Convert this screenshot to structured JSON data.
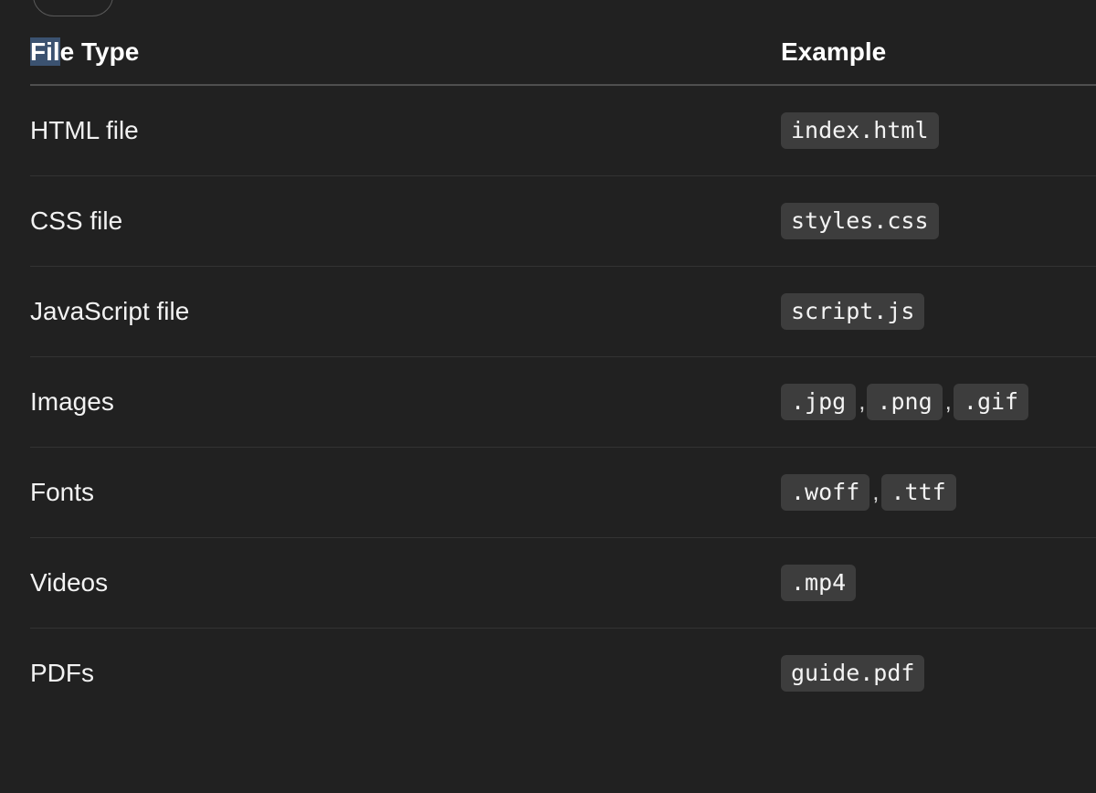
{
  "table": {
    "headers": {
      "file_type_highlight": "Fil",
      "file_type_rest": "e Type",
      "example": "Example"
    },
    "rows": [
      {
        "type": "HTML file",
        "examples": [
          "index.html"
        ]
      },
      {
        "type": "CSS file",
        "examples": [
          "styles.css"
        ]
      },
      {
        "type": "JavaScript file",
        "examples": [
          "script.js"
        ]
      },
      {
        "type": "Images",
        "examples": [
          ".jpg",
          ".png",
          ".gif"
        ]
      },
      {
        "type": "Fonts",
        "examples": [
          ".woff",
          ".ttf"
        ]
      },
      {
        "type": "Videos",
        "examples": [
          ".mp4"
        ]
      },
      {
        "type": "PDFs",
        "examples": [
          "guide.pdf"
        ]
      }
    ],
    "separator": ","
  },
  "colors": {
    "background": "#212121",
    "code_background": "#3d3d3d",
    "selection_highlight": "#3b5270"
  }
}
